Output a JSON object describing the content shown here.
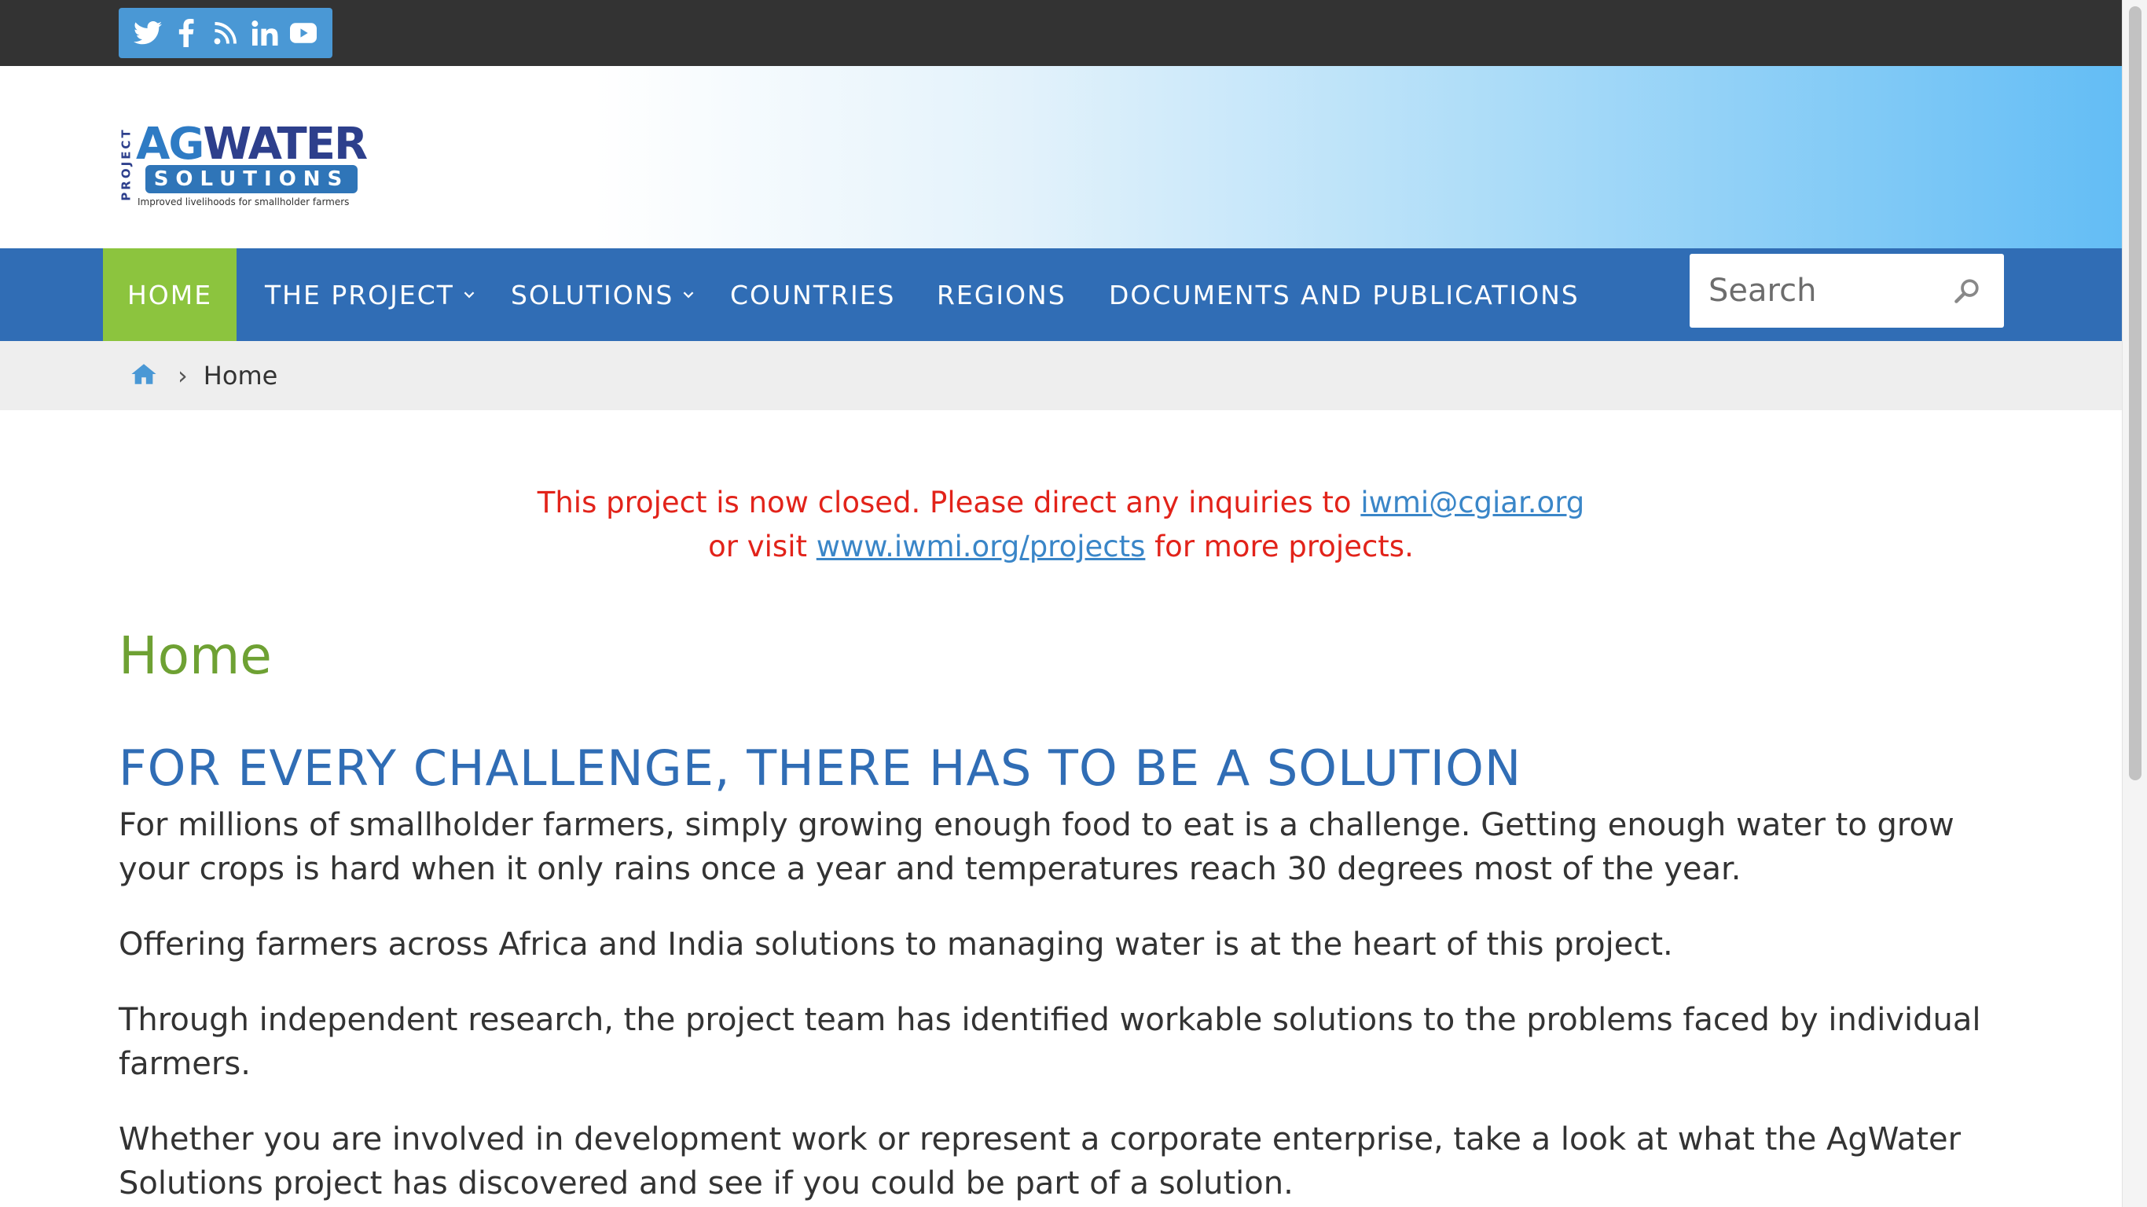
{
  "social": {
    "icons": [
      "twitter-icon",
      "facebook-icon",
      "rss-icon",
      "linkedin-icon",
      "youtube-icon"
    ],
    "background": "#4a98d5"
  },
  "logo": {
    "project": "PROJECT",
    "ag": "AG",
    "water": "WATER",
    "solutions": "SOLUTIONS",
    "tagline": "Improved livelihoods for smallholder farmers"
  },
  "nav": {
    "items": [
      {
        "label": "HOME",
        "active": true,
        "has_dropdown": false
      },
      {
        "label": "THE PROJECT",
        "active": false,
        "has_dropdown": true
      },
      {
        "label": "SOLUTIONS",
        "active": false,
        "has_dropdown": true
      },
      {
        "label": "COUNTRIES",
        "active": false,
        "has_dropdown": false
      },
      {
        "label": "REGIONS",
        "active": false,
        "has_dropdown": false
      },
      {
        "label": "DOCUMENTS AND PUBLICATIONS",
        "active": false,
        "has_dropdown": false
      }
    ],
    "search_placeholder": "Search",
    "background": "#306db5",
    "active_color": "#8cc43e"
  },
  "breadcrumb": {
    "current": "Home"
  },
  "notice": {
    "line1_text": "This project is now closed. Please direct any inquiries to ",
    "email_link": "iwmi@cgiar.org",
    "line2_prefix": "or visit ",
    "projects_link": "www.iwmi.org/projects",
    "line2_suffix": " for more projects.",
    "color": "#e2231a"
  },
  "content": {
    "page_title": "Home",
    "heading": "FOR EVERY CHALLENGE, THERE HAS TO BE A SOLUTION",
    "paragraphs": [
      "For millions of smallholder farmers, simply growing enough food to eat is a challenge. Getting enough water to grow your crops is hard when it only rains once a year and temperatures reach 30 degrees most of the year.",
      "Offering farmers across Africa and India solutions to managing water is at the heart of this project.",
      "Through independent research, the project team has identified workable solutions to the problems faced by individual farmers.",
      "Whether you are involved in development work or represent a corporate enterprise, take a look at what the AgWater Solutions project has discovered and see if you could be part of a solution."
    ]
  }
}
